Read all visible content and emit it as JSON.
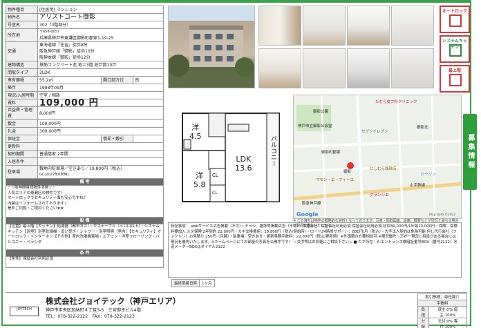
{
  "rows": [
    {
      "k": "物件種目",
      "v": "[住居用] マンション"
    },
    {
      "k": "物件名",
      "v": "アリストコート御影"
    },
    {
      "k": "号室名",
      "v": "302（3階部分）"
    },
    {
      "k": "所在地",
      "zip": "〒658-0057",
      "v": "兵庫県神戸市東灘区御影町郡家1-19-25"
    },
    {
      "k": "交通",
      "l1": "東海道線「住吉」徒歩8分",
      "l2": "阪急神戸線「御影」徒歩10分",
      "l3": "阪神本線「御影」徒歩12分"
    },
    {
      "k": "建物構造",
      "v": "鉄筋コンクリート造 地上3階 総戸数10戸"
    },
    {
      "k": "間取タイプ",
      "v": "2LDK"
    },
    {
      "k": "専有面積",
      "v": "55.2㎡",
      "k2": "開口部方位",
      "v2": "南"
    },
    {
      "k": "築年",
      "v": "1998年09月"
    },
    {
      "k": "現況/入居時期",
      "v": "空室 / 相談"
    },
    {
      "k": "賃料",
      "v": "109,000 円"
    },
    {
      "k": "共益費・管理費",
      "v": "8,000円"
    },
    {
      "k": "敷金",
      "v": "100,000円"
    },
    {
      "k": "礼金",
      "v": "300,000円"
    },
    {
      "k": "保証金",
      "v": "",
      "k2": "償却・敷引",
      "v2": ""
    },
    {
      "k": "更新料",
      "v": ""
    },
    {
      "k": "契約期間",
      "v": "普通借家 2年間"
    },
    {
      "k": "入居条件",
      "v": ""
    },
    {
      "k": "駐車場",
      "v": "敷地内駐車場／空きあり／19,800円（税込）",
      "v2": "GC(2022年6末時)"
    }
  ],
  "sections": {
    "bikou": "備 考",
    "setsubi": "設 備",
    "jouken": "条 件"
  },
  "bikou_text": [
    "☆☆阪神間賃貸物件多数☆☆",
    "人気エリアの東灘区の物件です！",
    "オートロックでセキュリティ面も安心ですね♪",
    "内装はリフォームされております♪",
    "是非ご内覧・ご検討ください★★"
  ],
  "setsubi_text": "【位置】最上階【キッチン】給湯器（都市ガス）・ガステーブル（三口口以上）・システムキッチン【浴室】浴室乾燥機・追い焚き・シャワー・浴室照明（室内）【セキュリティ】オートロック・インターホン【その他】室内洗濯機置場・エアコン・洋室フローリング・バルコニー・ベランダ",
  "jouken_text": "【条件】保証会社利用必須",
  "badges": [
    "オートロック",
    "システムキッチン",
    "最上階"
  ],
  "sidetab": "募集情報",
  "plan": {
    "room1": "洋",
    "room1_size": "4.5",
    "room2": "洋",
    "room2_size": "5.8",
    "ldk": "LDK",
    "ldk_size": "13.6",
    "balcony": "バルコニー",
    "cl": "CL",
    "cl2": "CL"
  },
  "map": {
    "labels": [
      "たむら皮フ科クリニック",
      "御影公園",
      "神戸市立御影公会堂",
      "御影北",
      "セブンイレブン",
      "御影町郡家",
      "御影",
      "にしむら珈琲店",
      "ローソン",
      "マモン・エ・フィーユ",
      "グランジエ",
      "山手幹線",
      "阪急神戸線"
    ],
    "attribution": "Map data ©2022",
    "google": "Google"
  },
  "map_note": "※ この資料は物件の概略的な資料となっております。写真・間取図面、設備、概要などが現況と異なる場合は現況を優先いたします。",
  "remarks_title": "特記事項：",
  "remarks": "webサービス広告掲載（不可）・チラシ、雑誌等掲載広告（不可）・保証会社：保証会社利用必須 保証会社利用必須 初回30,000円/1年毎10,000円・保険：保険料要加入 火災保険 2年契約 22,000円・カギ交換費用：19,800円（税込/契約時）・ロード24時間サポート：880円/月（税込）・大手法人契約は免除可能 但し代行会社（ファクトリ）お見積り 250円（月額）・駐車場：空きあり・更新事務手数料：22,000円（税込/更新時）※外国籍の方要相談可 ※現況優先・万が一現況と相違がある場合には現況を優先いたします。※ホームページにてお部屋の写真を公開中です！ ☆交渉等はお気軽にご相談下さい☆ ■ カギ所在：A エントランス横暗証番号BOX（番号2122）水道メーターBOXはダイヤル2122",
  "regdate_k": "最終取扱日時",
  "regdate_v": "1ヶ月",
  "company": "株式会社ジョイテック（神戸エリア）",
  "address": "神戸市中央区加納町４丁目3-5　三宮御幸ビル4階",
  "tel": "TEL：078-322-2122　FAX：078-322-2123",
  "logo": "JOYTECH",
  "deal": {
    "title": "取引態様：専任媒介",
    "fee_title": "手数料",
    "r1k": "負担",
    "r1v": "貸主:0% 借主:100%",
    "r2k": "分配",
    "r2v": "元付:0% 客付:100%"
  }
}
